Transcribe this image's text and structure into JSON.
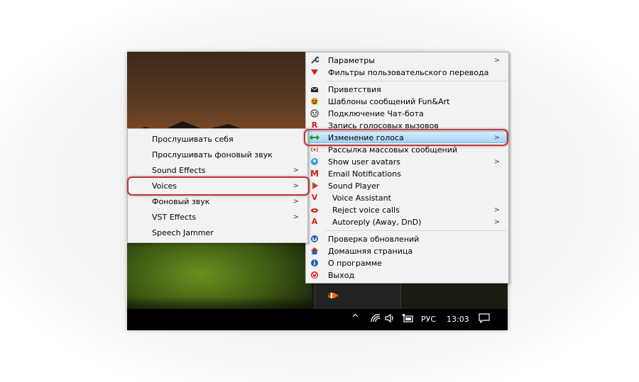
{
  "right_menu": {
    "items": [
      {
        "label": "Параметры",
        "icon": "wrench-icon",
        "submenu": true
      },
      {
        "label": "Фильтры пользовательского перевода",
        "icon": "filter-icon",
        "submenu": false
      },
      {
        "label": "Приветствия",
        "icon": "envelope-icon",
        "submenu": false
      },
      {
        "label": "Шаблоны сообщений Fun&Art",
        "icon": "smiley-icon",
        "submenu": false
      },
      {
        "label": "Подключение Чат-бота",
        "icon": "bot-face-icon",
        "submenu": false
      },
      {
        "label": "Запись голосовых вызовов",
        "icon": "record-r-icon",
        "submenu": false
      },
      {
        "label": "Изменение голоса",
        "icon": "voice-change-arrows-icon",
        "submenu": true
      },
      {
        "label": "Рассылка массовых сообщений",
        "icon": "broadcast-icon",
        "submenu": false
      },
      {
        "label": "Show user avatars",
        "icon": "avatar-icon",
        "submenu": true
      },
      {
        "label": "Email Notifications",
        "icon": "gmail-icon",
        "submenu": false
      },
      {
        "label": "Sound Player",
        "icon": "play-icon",
        "submenu": false
      },
      {
        "label": "Voice Assistant",
        "icon": "v-letter-icon",
        "submenu": false
      },
      {
        "label": "Reject voice calls",
        "icon": "reject-call-icon",
        "submenu": true
      },
      {
        "label": "Autoreply (Away, DnD)",
        "icon": "a-letter-icon",
        "submenu": true
      },
      {
        "label": "Проверка обновлений",
        "icon": "update-icon",
        "submenu": false
      },
      {
        "label": "Домашняя страница",
        "icon": "home-icon",
        "submenu": false
      },
      {
        "label": "О программе",
        "icon": "info-icon",
        "submenu": false
      },
      {
        "label": "Выход",
        "icon": "power-icon",
        "submenu": false
      }
    ]
  },
  "left_menu": {
    "items": [
      {
        "label": "Прослушивать себя",
        "submenu": false
      },
      {
        "label": "Прослушивать фоновый звук",
        "submenu": false
      },
      {
        "label": "Sound Effects",
        "submenu": true
      },
      {
        "label": "Voices",
        "submenu": true
      },
      {
        "label": "Фоновый звук",
        "submenu": true
      },
      {
        "label": "VST Effects",
        "submenu": true
      },
      {
        "label": "Speech Jammer",
        "submenu": false
      }
    ]
  },
  "taskbar": {
    "language": "РУС",
    "time": "13:03",
    "chevron": "^"
  },
  "submenu_arrow": ">",
  "colors": {
    "highlight_border": "#b83a3a",
    "selection_blue": "#a9d2f5"
  }
}
